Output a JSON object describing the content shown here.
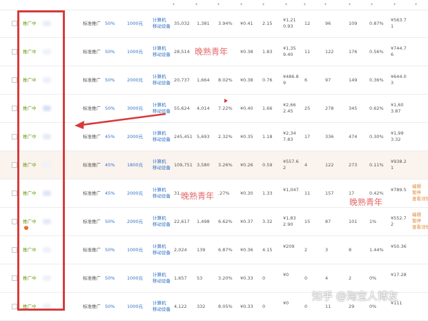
{
  "filter_icon": "filter-icon",
  "rows": [
    {
      "status": "推广中",
      "type": "标准推广",
      "rate": "50%",
      "budget": "1000元",
      "dev1": "计算机",
      "dev2": "移动设备",
      "c1": "35,032",
      "c2": "1,381",
      "c3": "3.94%",
      "c4": "¥0.41",
      "c5": "2.15",
      "c6a": "¥1,21",
      "c6b": "0.93",
      "c7": "12",
      "c8": "96",
      "c9": "109",
      "c10": "0.87%",
      "c11a": "¥563.7",
      "c11b": "1"
    },
    {
      "status": "推广中",
      "type": "标准推广",
      "rate": "50%",
      "budget": "1000元",
      "dev1": "计算机",
      "dev2": "移动设备",
      "c1": "28,514",
      "c2": "",
      "c3": "",
      "c4": "¥0.38",
      "c5": "1.83",
      "c6a": "¥1,35",
      "c6b": "9.40",
      "c7": "11",
      "c8": "122",
      "c9": "176",
      "c10": "0.56%",
      "c11a": "¥744.7",
      "c11b": "6"
    },
    {
      "status": "推广中",
      "type": "标准推广",
      "rate": "50%",
      "budget": "2000元",
      "dev1": "计算机",
      "dev2": "移动设备",
      "c1": "20,737",
      "c2": "1,664",
      "c3": "8.02%",
      "c4": "¥0.38",
      "c5": "0.76",
      "c6a": "¥486.8",
      "c6b": "9",
      "c7": "6",
      "c8": "97",
      "c9": "149",
      "c10": "0.36%",
      "c11a": "¥644.0",
      "c11b": "3"
    },
    {
      "status": "推广中",
      "type": "标准推广",
      "rate": "50%",
      "budget": "3000元",
      "dev1": "计算机",
      "dev2": "移动设备",
      "c1": "55,624",
      "c2": "4,014",
      "c3": "7.22%",
      "c4": "¥0.40",
      "c5": "1.66",
      "c6a": "¥2,66",
      "c6b": "2.45",
      "c7": "25",
      "c8": "278",
      "c9": "345",
      "c10": "0.62%",
      "c11a": "¥1,60",
      "c11b": "3.87"
    },
    {
      "status": "推广中",
      "type": "标准推广",
      "rate": "45%",
      "budget": "2000元",
      "dev1": "计算机",
      "dev2": "移动设备",
      "c1": "245,451",
      "c2": "5,693",
      "c3": "2.32%",
      "c4": "¥0.35",
      "c5": "1.18",
      "c6a": "¥2,34",
      "c6b": "7.83",
      "c7": "17",
      "c8": "336",
      "c9": "474",
      "c10": "0.30%",
      "c11a": "¥1,99",
      "c11b": "3.32"
    },
    {
      "status": "推广中",
      "type": "标准推广",
      "rate": "45%",
      "budget": "1800元",
      "dev1": "计算机",
      "dev2": "移动设备",
      "c1": "109,751",
      "c2": "3,580",
      "c3": "3.26%",
      "c4": "¥0.26",
      "c5": "0.59",
      "c6a": "¥557.6",
      "c6b": "2",
      "c7": "4",
      "c8": "122",
      "c9": "273",
      "c10": "0.11%",
      "c11a": "¥938.2",
      "c11b": "1"
    },
    {
      "status": "推广中",
      "type": "标准推广",
      "rate": "45%",
      "budget": "2000元",
      "dev1": "计算机",
      "dev2": "移动设备",
      "c1": "31,",
      "c2": "",
      "c3": ".27%",
      "c4": "¥0.30",
      "c5": "1.33",
      "c6a": "¥1,047",
      "c6b": "",
      "c7": "11",
      "c8": "157",
      "c9": "17",
      "c10": "0.42%",
      "c11a": "¥789.5",
      "c11b": ""
    },
    {
      "status": "推广中",
      "type": "标准推广",
      "rate": "50%",
      "budget": "2000元",
      "dev1": "计算机",
      "dev2": "移动设备",
      "c1": "22,617",
      "c2": "1,498",
      "c3": "6.62%",
      "c4": "¥0.37",
      "c5": "3.32",
      "c6a": "¥1,83",
      "c6b": "2.90",
      "c7": "15",
      "c8": "87",
      "c9": "101",
      "c10": "1%",
      "c11a": "¥552.7",
      "c11b": "2"
    },
    {
      "status": "推广中",
      "type": "标准推广",
      "rate": "50%",
      "budget": "1000元",
      "dev1": "计算机",
      "dev2": "移动设备",
      "c1": "2,024",
      "c2": "139",
      "c3": "6.87%",
      "c4": "¥0.36",
      "c5": "4.15",
      "c6a": "¥209",
      "c6b": "",
      "c7": "2",
      "c8": "3",
      "c9": "8",
      "c10": "1.44%",
      "c11a": "¥50.36",
      "c11b": ""
    },
    {
      "status": "推广中",
      "type": "标准推广",
      "rate": "50%",
      "budget": "1000元",
      "dev1": "计算机",
      "dev2": "移动设备",
      "c1": "1,657",
      "c2": "53",
      "c3": "3.20%",
      "c4": "¥0.33",
      "c5": "0",
      "c6a": "¥0",
      "c6b": "",
      "c7": "0",
      "c8": "4",
      "c9": "2",
      "c10": "0%",
      "c11a": "¥17.28",
      "c11b": ""
    },
    {
      "status": "推广中",
      "type": "标准推广",
      "rate": "50%",
      "budget": "1000元",
      "dev1": "计算机",
      "dev2": "移动设备",
      "c1": "4,122",
      "c2": "332",
      "c3": "8.05%",
      "c4": "¥0.33",
      "c5": "0",
      "c6a": "¥0",
      "c6b": "",
      "c7": "0",
      "c8": "11",
      "c9": "29",
      "c10": "0%",
      "c11a": "¥111",
      "c11b": ""
    }
  ],
  "ops_links": [
    "编辑",
    "暂停",
    "查看详情"
  ],
  "watermarks": [
    "晚熟青年",
    "晚熟青年",
    "晚熟青年"
  ],
  "zhihu_watermark": "知乎 @淘宝人博友",
  "colors": {
    "status": "#6a9a10",
    "link": "#2e72c6",
    "highlight_row": "#fbf3ee",
    "box": "#d63a3a"
  }
}
